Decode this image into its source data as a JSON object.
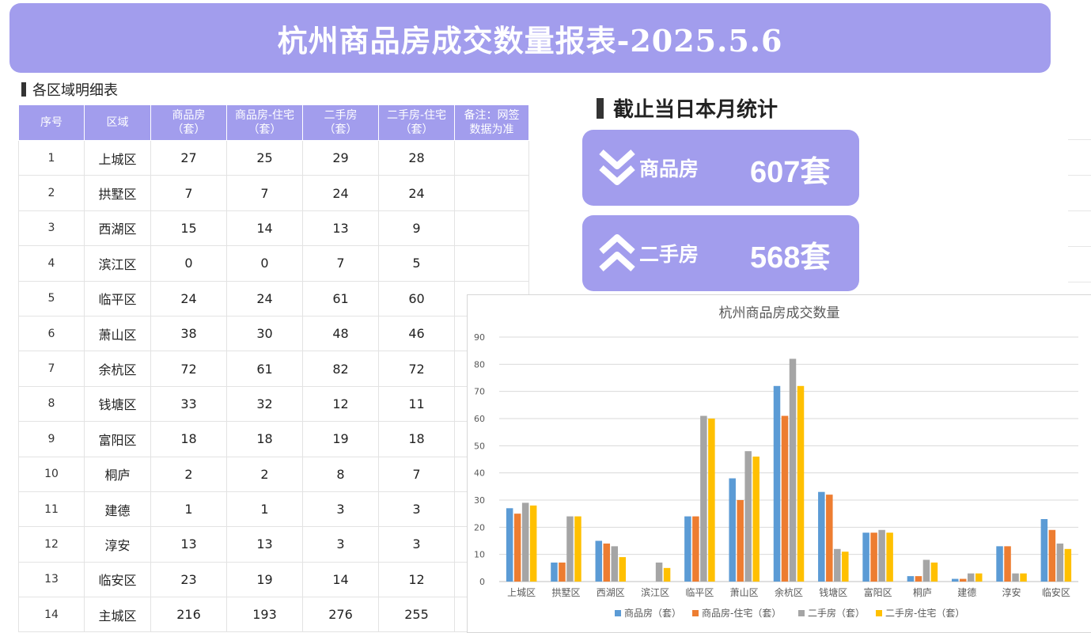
{
  "banner": {
    "title": "杭州商品房成交数量报表-2025.5.6"
  },
  "left_section": {
    "title": "各区域明细表"
  },
  "table": {
    "headers": [
      {
        "line1": "序号",
        "line2": ""
      },
      {
        "line1": "区域",
        "line2": ""
      },
      {
        "line1": "商品房",
        "line2": "（套）"
      },
      {
        "line1": "商品房-住宅",
        "line2": "（套）"
      },
      {
        "line1": "二手房",
        "line2": "（套）"
      },
      {
        "line1": "二手房-住宅",
        "line2": "（套）"
      },
      {
        "line1": "备注：网签",
        "line2": "数据为准"
      }
    ],
    "rows": [
      {
        "seq": "1",
        "area": "上城区",
        "v1": "27",
        "v2": "25",
        "v3": "29",
        "v4": "28"
      },
      {
        "seq": "2",
        "area": "拱墅区",
        "v1": "7",
        "v2": "7",
        "v3": "24",
        "v4": "24"
      },
      {
        "seq": "3",
        "area": "西湖区",
        "v1": "15",
        "v2": "14",
        "v3": "13",
        "v4": "9"
      },
      {
        "seq": "4",
        "area": "滨江区",
        "v1": "0",
        "v2": "0",
        "v3": "7",
        "v4": "5"
      },
      {
        "seq": "5",
        "area": "临平区",
        "v1": "24",
        "v2": "24",
        "v3": "61",
        "v4": "60"
      },
      {
        "seq": "6",
        "area": "萧山区",
        "v1": "38",
        "v2": "30",
        "v3": "48",
        "v4": "46"
      },
      {
        "seq": "7",
        "area": "余杭区",
        "v1": "72",
        "v2": "61",
        "v3": "82",
        "v4": "72"
      },
      {
        "seq": "8",
        "area": "钱塘区",
        "v1": "33",
        "v2": "32",
        "v3": "12",
        "v4": "11"
      },
      {
        "seq": "9",
        "area": "富阳区",
        "v1": "18",
        "v2": "18",
        "v3": "19",
        "v4": "18"
      },
      {
        "seq": "10",
        "area": "桐庐",
        "v1": "2",
        "v2": "2",
        "v3": "8",
        "v4": "7"
      },
      {
        "seq": "11",
        "area": "建德",
        "v1": "1",
        "v2": "1",
        "v3": "3",
        "v4": "3"
      },
      {
        "seq": "12",
        "area": "淳安",
        "v1": "13",
        "v2": "13",
        "v3": "3",
        "v4": "3"
      },
      {
        "seq": "13",
        "area": "临安区",
        "v1": "23",
        "v2": "19",
        "v3": "14",
        "v4": "12"
      },
      {
        "seq": "14",
        "area": "主城区",
        "v1": "216",
        "v2": "193",
        "v3": "276",
        "v4": "255"
      }
    ]
  },
  "right_section": {
    "title": "截止当日本月统计"
  },
  "stats": [
    {
      "label": "商品房",
      "value": "607套",
      "icon": "double-chevron-down-icon"
    },
    {
      "label": "二手房",
      "value": "568套",
      "icon": "double-chevron-up-icon"
    }
  ],
  "colors": {
    "accent": "#a29ded",
    "series": [
      "#5b9bd5",
      "#ed7d31",
      "#a5a5a5",
      "#ffc000"
    ]
  },
  "chart_data": {
    "type": "bar",
    "title": "杭州商品房成交数量",
    "categories": [
      "上城区",
      "拱墅区",
      "西湖区",
      "滨江区",
      "临平区",
      "萧山区",
      "余杭区",
      "钱塘区",
      "富阳区",
      "桐庐",
      "建德",
      "淳安",
      "临安区"
    ],
    "series": [
      {
        "name": "商品房（套）",
        "values": [
          27,
          7,
          15,
          0,
          24,
          38,
          72,
          33,
          18,
          2,
          1,
          13,
          23
        ]
      },
      {
        "name": "商品房-住宅（套）",
        "values": [
          25,
          7,
          14,
          0,
          24,
          30,
          61,
          32,
          18,
          2,
          1,
          13,
          19
        ]
      },
      {
        "name": "二手房（套）",
        "values": [
          29,
          24,
          13,
          7,
          61,
          48,
          82,
          12,
          19,
          8,
          3,
          3,
          14
        ]
      },
      {
        "name": "二手房-住宅（套）",
        "values": [
          28,
          24,
          9,
          5,
          60,
          46,
          72,
          11,
          18,
          7,
          3,
          3,
          12
        ]
      }
    ],
    "ylim": [
      0,
      90
    ],
    "yticks": [
      0,
      10,
      20,
      30,
      40,
      50,
      60,
      70,
      80,
      90
    ],
    "grid": true,
    "legend": "bottom"
  }
}
